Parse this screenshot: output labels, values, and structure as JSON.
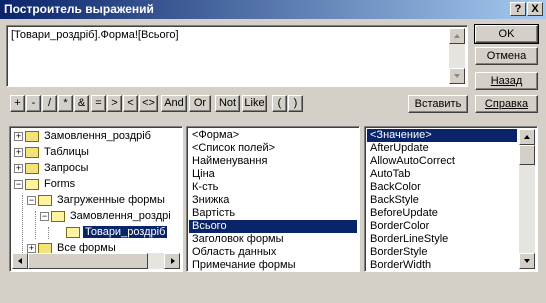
{
  "window": {
    "title": "Построитель выражений",
    "help_button": "?",
    "close_button": "X"
  },
  "expression": {
    "text": "[Товари_роздріб].Форма![Всього]"
  },
  "buttons": {
    "ok": "OK",
    "cancel": "Отмена",
    "back": "Назад",
    "help": "Справка",
    "insert": "Вставить"
  },
  "operators": [
    "+",
    "-",
    "/",
    "*",
    "&",
    "=",
    ">",
    "<",
    "<>",
    "And",
    "Or",
    "Not",
    "Like",
    "(",
    ")"
  ],
  "tree": {
    "items": [
      {
        "label": "Замовлення_роздріб",
        "expander": "+",
        "open": false
      },
      {
        "label": "Таблицы",
        "expander": "+",
        "open": false
      },
      {
        "label": "Запросы",
        "expander": "+",
        "open": false
      },
      {
        "label": "Forms",
        "expander": "−",
        "open": true
      },
      {
        "label": "Загруженные формы",
        "expander": "−",
        "open": true
      },
      {
        "label": "Замовлення_роздрі",
        "expander": "−",
        "open": true
      },
      {
        "label": "Товари_роздріб",
        "expander": "",
        "open": true,
        "selected": true
      },
      {
        "label": "Все формы",
        "expander": "+",
        "open": false
      }
    ]
  },
  "fields": {
    "items": [
      "<Форма>",
      "<Список полей>",
      "Найменування",
      "Ціна",
      "К-сть",
      "Знижка",
      "Вартість",
      "Всього",
      "Заголовок формы",
      "Область данных",
      "Примечание формы"
    ],
    "selected_index": 7
  },
  "properties": {
    "items": [
      "<Значение>",
      "AfterUpdate",
      "AllowAutoCorrect",
      "AutoTab",
      "BackColor",
      "BackStyle",
      "BeforeUpdate",
      "BorderColor",
      "BorderLineStyle",
      "BorderStyle",
      "BorderWidth"
    ],
    "selected_index": 0
  },
  "colors": {
    "title_start": "#0a246a",
    "title_end": "#a6caf0",
    "selection": "#0a246a",
    "face": "#d4d0c8"
  }
}
